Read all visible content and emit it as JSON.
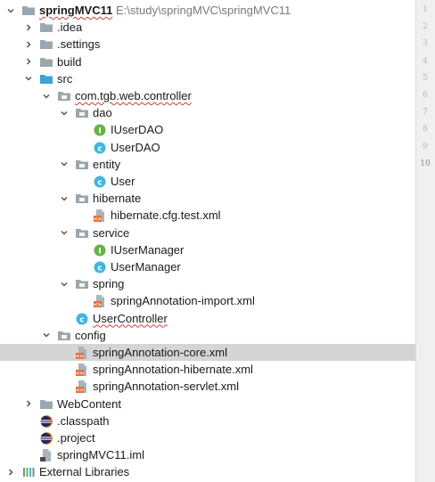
{
  "project": {
    "name": "springMVC11",
    "path": "E:\\study\\springMVC\\springMVC11"
  },
  "tree": [
    {
      "label": "springMVC11",
      "depth": 0,
      "arrow": "down",
      "icon": "folder-icon",
      "bold": true,
      "err": true,
      "path": "E:\\study\\springMVC\\springMVC11"
    },
    {
      "label": ".idea",
      "depth": 1,
      "arrow": "right",
      "icon": "folder-icon"
    },
    {
      "label": ".settings",
      "depth": 1,
      "arrow": "right",
      "icon": "folder-icon"
    },
    {
      "label": "build",
      "depth": 1,
      "arrow": "right",
      "icon": "folder-icon"
    },
    {
      "label": "src",
      "depth": 1,
      "arrow": "down",
      "icon": "source-folder-icon"
    },
    {
      "label": "com.tgb.web.controller",
      "depth": 2,
      "arrow": "down",
      "icon": "package-icon",
      "err": true
    },
    {
      "label": "dao",
      "depth": 3,
      "arrow": "down",
      "icon": "package-icon"
    },
    {
      "label": "IUserDAO",
      "depth": 4,
      "icon": "interface-icon"
    },
    {
      "label": "UserDAO",
      "depth": 4,
      "icon": "class-icon"
    },
    {
      "label": "entity",
      "depth": 3,
      "arrow": "down",
      "icon": "package-icon"
    },
    {
      "label": "User",
      "depth": 4,
      "icon": "class-icon"
    },
    {
      "label": "hibernate",
      "depth": 3,
      "arrow": "down",
      "icon": "package-icon"
    },
    {
      "label": "hibernate.cfg.test.xml",
      "depth": 4,
      "icon": "xml-file-icon"
    },
    {
      "label": "service",
      "depth": 3,
      "arrow": "down",
      "icon": "package-icon"
    },
    {
      "label": "IUserManager",
      "depth": 4,
      "icon": "interface-icon"
    },
    {
      "label": "UserManager",
      "depth": 4,
      "icon": "class-icon"
    },
    {
      "label": "spring",
      "depth": 3,
      "arrow": "down",
      "icon": "package-icon"
    },
    {
      "label": "springAnnotation-import.xml",
      "depth": 4,
      "icon": "xml-file-icon"
    },
    {
      "label": "UserController",
      "depth": 3,
      "icon": "class-icon",
      "err": true
    },
    {
      "label": "config",
      "depth": 2,
      "arrow": "down",
      "icon": "package-icon"
    },
    {
      "label": "springAnnotation-core.xml",
      "depth": 3,
      "icon": "xml-file-icon",
      "selected": true
    },
    {
      "label": "springAnnotation-hibernate.xml",
      "depth": 3,
      "icon": "xml-file-icon"
    },
    {
      "label": "springAnnotation-servlet.xml",
      "depth": 3,
      "icon": "xml-file-icon"
    },
    {
      "label": "WebContent",
      "depth": 1,
      "arrow": "right",
      "icon": "folder-icon"
    },
    {
      "label": ".classpath",
      "depth": 1,
      "icon": "eclipse-file-icon"
    },
    {
      "label": ".project",
      "depth": 1,
      "icon": "eclipse-file-icon"
    },
    {
      "label": "springMVC11.iml",
      "depth": 1,
      "icon": "iml-file-icon"
    },
    {
      "label": "External Libraries",
      "depth": 0,
      "arrow": "right",
      "icon": "libraries-icon"
    }
  ],
  "gutter": {
    "line_numbers": [
      "1",
      "2",
      "3",
      "4",
      "5",
      "6",
      "7",
      "8",
      "9",
      "10"
    ],
    "active_line": "10"
  },
  "colors": {
    "folder": "#9aa7b0",
    "source_folder": "#40a0d8",
    "package": "#9aa7b0",
    "class": "#40b6e0",
    "interface": "#62b543",
    "xml": "#e0733b",
    "selection": "#d5d5d5",
    "error_underline": "#d23c3c"
  }
}
